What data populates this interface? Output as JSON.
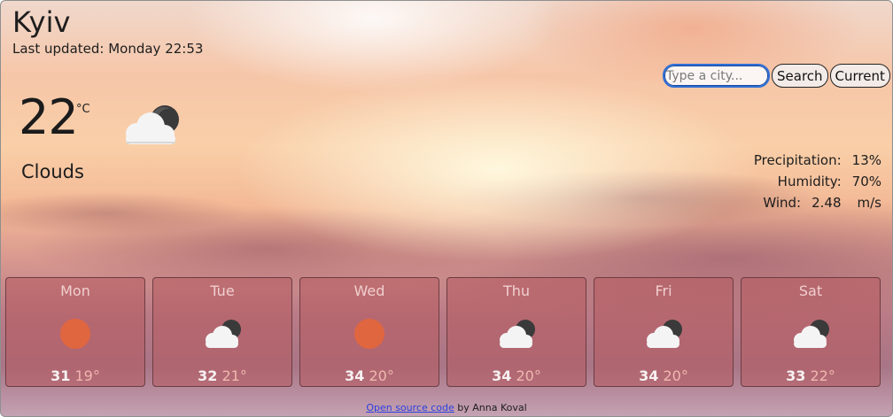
{
  "city": "Kyiv",
  "last_updated": "Last updated: Monday 22:53",
  "search": {
    "placeholder": "Type a city...",
    "search_label": "Search",
    "current_label": "Current"
  },
  "current": {
    "temperature": "22",
    "unit": "°C",
    "description": "Clouds",
    "icon": "cloud-moon-icon"
  },
  "details": [
    {
      "label": "Precipitation:",
      "value": "13%",
      "unit": ""
    },
    {
      "label": "Humidity:",
      "value": "70%",
      "unit": ""
    },
    {
      "label": "Wind:",
      "value": "2.48",
      "unit": "m/s"
    }
  ],
  "forecast": [
    {
      "day": "Mon",
      "icon": "sun-icon",
      "max": "31",
      "min": "19°"
    },
    {
      "day": "Tue",
      "icon": "cloud-moon-icon",
      "max": "32",
      "min": "21°"
    },
    {
      "day": "Wed",
      "icon": "sun-icon",
      "max": "34",
      "min": "20°"
    },
    {
      "day": "Thu",
      "icon": "cloud-moon-icon",
      "max": "34",
      "min": "20°"
    },
    {
      "day": "Fri",
      "icon": "cloud-moon-icon",
      "max": "34",
      "min": "20°"
    },
    {
      "day": "Sat",
      "icon": "cloud-moon-icon",
      "max": "33",
      "min": "22°"
    }
  ],
  "footer": {
    "link_text": "Open source code",
    "byline": " by Anna Koval"
  },
  "colors": {
    "sun": "#e0663f",
    "card_bg": "#b45a5f",
    "focus_ring": "#2f6fd6"
  }
}
